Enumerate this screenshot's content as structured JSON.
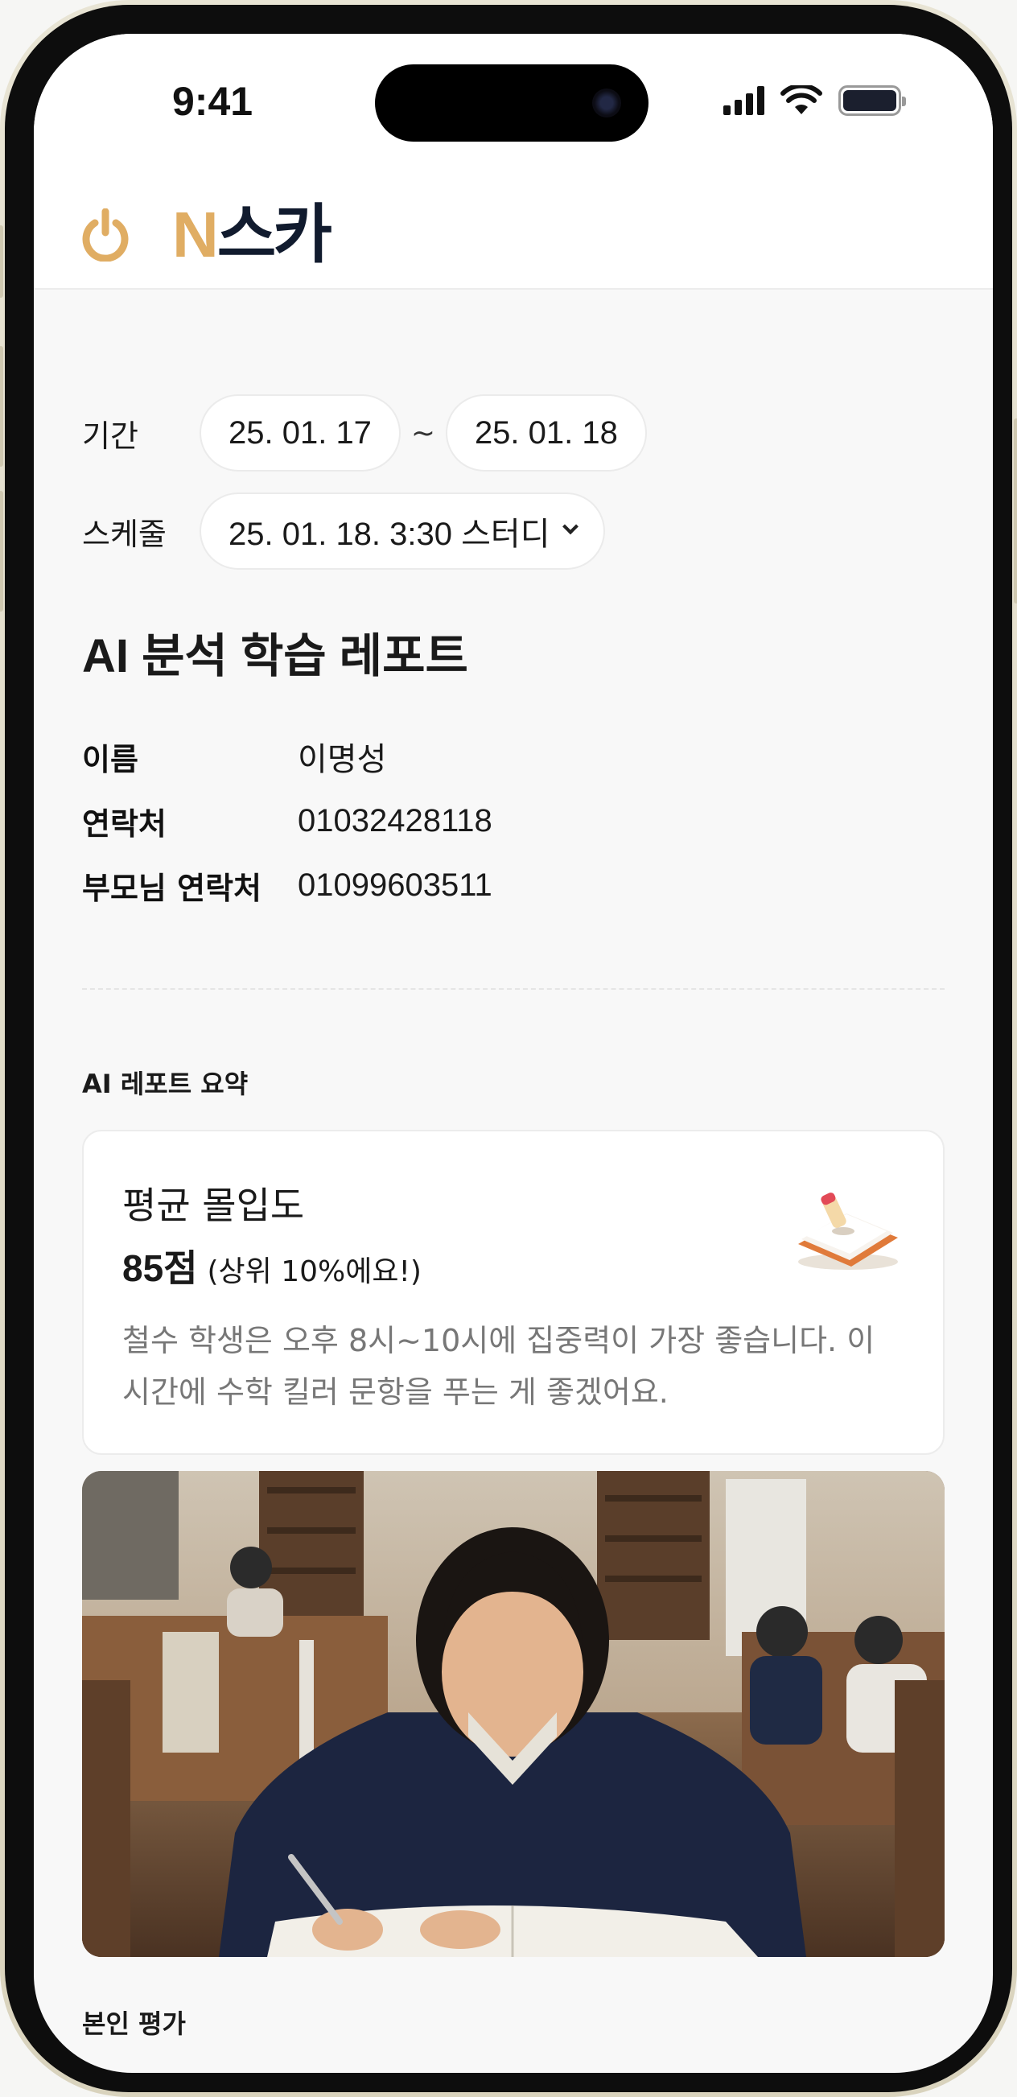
{
  "status_bar": {
    "time": "9:41"
  },
  "header": {
    "logo_on": "ON",
    "logo_ska": "스카"
  },
  "filters": {
    "period_label": "기간",
    "start_date": "25. 01. 17",
    "separator": "~",
    "end_date": "25. 01. 18",
    "schedule_label": "스케줄",
    "schedule_value": "25. 01. 18. 3:30 스터디"
  },
  "report": {
    "title": "AI 분석 학습 레포트",
    "info": [
      {
        "key": "이름",
        "value": "이명성"
      },
      {
        "key": "연락처",
        "value": "01032428118"
      },
      {
        "key": "부모님 연락처",
        "value": "01099603511"
      }
    ]
  },
  "summary": {
    "section_title": "AI 레포트 요약",
    "card_title": "평균 몰입도",
    "score": "85점",
    "rank": "(상위 10%에요!)",
    "description": "철수 학생은 오후 8시~10시에 집중력이 가장 좋습니다. 이 시간에 수학 킬러 문항을 푸는 게 좋겠어요."
  },
  "self_evaluation": {
    "section_title": "본인 평가"
  },
  "colors": {
    "brand_orange": "#e0ad63",
    "brand_navy": "#111b2e",
    "background": "#f8f8f8"
  }
}
